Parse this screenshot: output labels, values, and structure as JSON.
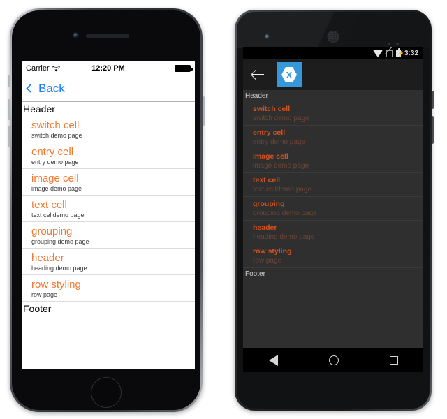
{
  "ios": {
    "device_name": "iphone-device",
    "statusbar": {
      "carrier": "Carrier",
      "wifi_icon": "wifi-icon",
      "time": "12:20 PM",
      "battery_icon": "battery-full-icon"
    },
    "navbar": {
      "back_label": "Back",
      "back_icon": "chevron-left-icon"
    },
    "list": {
      "header": "Header",
      "footer": "Footer",
      "rows": [
        {
          "title": "switch cell",
          "detail": "switch demo page"
        },
        {
          "title": "entry cell",
          "detail": "entry demo page"
        },
        {
          "title": "image cell",
          "detail": "image demo page"
        },
        {
          "title": "text cell",
          "detail": "text celldemo page"
        },
        {
          "title": "grouping",
          "detail": "grouping demo page"
        },
        {
          "title": "header",
          "detail": "heading demo page"
        },
        {
          "title": "row styling",
          "detail": "row page"
        }
      ]
    },
    "colors": {
      "title": "#f4772e",
      "detail": "#3b3b3b",
      "accent": "#157efb",
      "background": "#ffffff",
      "separator": "#dcdcdc"
    }
  },
  "android": {
    "device_name": "android-device",
    "statusbar": {
      "wifi_icon": "wifi-icon",
      "signal_icon": "no-signal-icon",
      "battery_icon": "battery-charging-icon",
      "time": "3:32"
    },
    "actionbar": {
      "back_icon": "arrow-left-icon",
      "app_logo": "xamarin-logo-icon"
    },
    "list": {
      "header": "Header",
      "footer": "Footer",
      "rows": [
        {
          "title": "switch cell",
          "detail": "switch demo page"
        },
        {
          "title": "entry cell",
          "detail": "entry demo page"
        },
        {
          "title": "image cell",
          "detail": "image demo page"
        },
        {
          "title": "text cell",
          "detail": "text celldemo page"
        },
        {
          "title": "grouping",
          "detail": "grouping demo page"
        },
        {
          "title": "header",
          "detail": "heading demo page"
        },
        {
          "title": "row styling",
          "detail": "row page"
        }
      ]
    },
    "navbar": {
      "back_icon": "triangle-back-icon",
      "home_icon": "circle-home-icon",
      "recents_icon": "square-recents-icon"
    },
    "colors": {
      "title": "#d4521e",
      "detail": "#6b4436",
      "background": "#2f2f2f",
      "actionbar": "#1d1d1d",
      "section_label": "#cfcfcf",
      "logo_blue": "#3498db",
      "separator": "#3a3a3a"
    }
  }
}
